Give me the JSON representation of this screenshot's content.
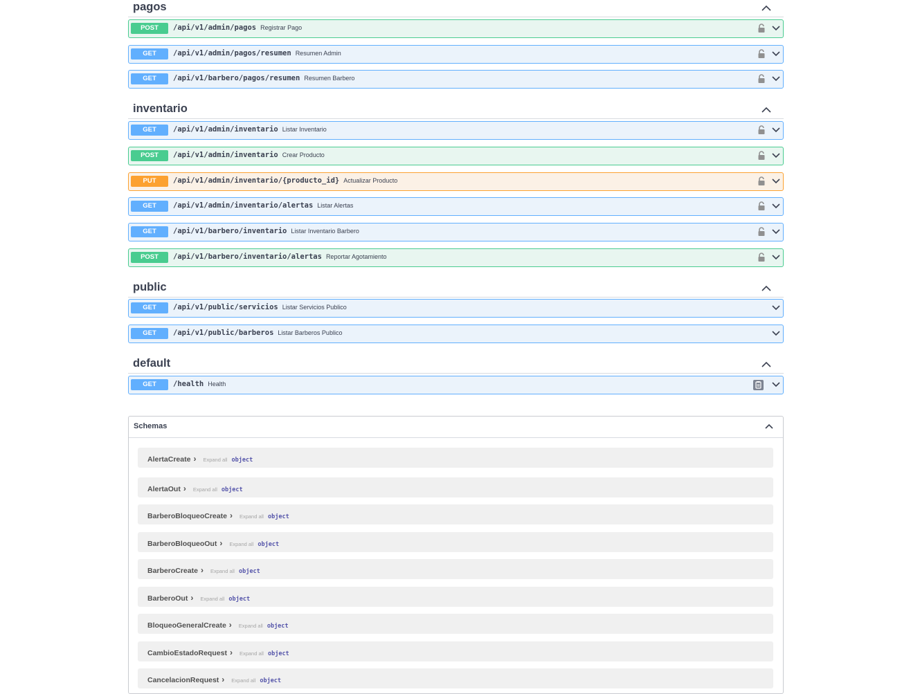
{
  "tags": [
    {
      "name": "pagos",
      "operations": [
        {
          "method": "POST",
          "path": "/api/v1/admin/pagos",
          "summary": "Registrar Pago",
          "icon": "lock-icon"
        },
        {
          "method": "GET",
          "path": "/api/v1/admin/pagos/resumen",
          "summary": "Resumen Admin",
          "icon": "lock-icon"
        },
        {
          "method": "GET",
          "path": "/api/v1/barbero/pagos/resumen",
          "summary": "Resumen Barbero",
          "icon": "lock-icon"
        }
      ]
    },
    {
      "name": "inventario",
      "operations": [
        {
          "method": "GET",
          "path": "/api/v1/admin/inventario",
          "summary": "Listar Inventario",
          "icon": "lock-icon"
        },
        {
          "method": "POST",
          "path": "/api/v1/admin/inventario",
          "summary": "Crear Producto",
          "icon": "lock-icon"
        },
        {
          "method": "PUT",
          "path": "/api/v1/admin/inventario/{producto_id}",
          "summary": "Actualizar Producto",
          "icon": "lock-icon"
        },
        {
          "method": "GET",
          "path": "/api/v1/admin/inventario/alertas",
          "summary": "Listar Alertas",
          "icon": "lock-icon"
        },
        {
          "method": "GET",
          "path": "/api/v1/barbero/inventario",
          "summary": "Listar Inventario Barbero",
          "icon": "lock-icon"
        },
        {
          "method": "POST",
          "path": "/api/v1/barbero/inventario/alertas",
          "summary": "Reportar Agotamiento",
          "icon": "lock-icon"
        }
      ]
    },
    {
      "name": "public",
      "operations": [
        {
          "method": "GET",
          "path": "/api/v1/public/servicios",
          "summary": "Listar Servicios Publico",
          "icon": ""
        },
        {
          "method": "GET",
          "path": "/api/v1/public/barberos",
          "summary": "Listar Barberos Publico",
          "icon": ""
        }
      ]
    },
    {
      "name": "default",
      "operations": [
        {
          "method": "GET",
          "path": "/health",
          "summary": "Health",
          "icon": "copy-icon"
        }
      ]
    }
  ],
  "schemas": {
    "title": "Schemas",
    "expand_label": "Expand all",
    "type_label": "object",
    "items": [
      "AlertaCreate",
      "AlertaOut",
      "BarberoBloqueoCreate",
      "BarberoBloqueoOut",
      "BarberoCreate",
      "BarberoOut",
      "BloqueoGeneralCreate",
      "CambioEstadoRequest",
      "CancelacionRequest"
    ]
  },
  "colors": {
    "get": "#61affe",
    "post": "#49cc90",
    "put": "#fca130"
  }
}
